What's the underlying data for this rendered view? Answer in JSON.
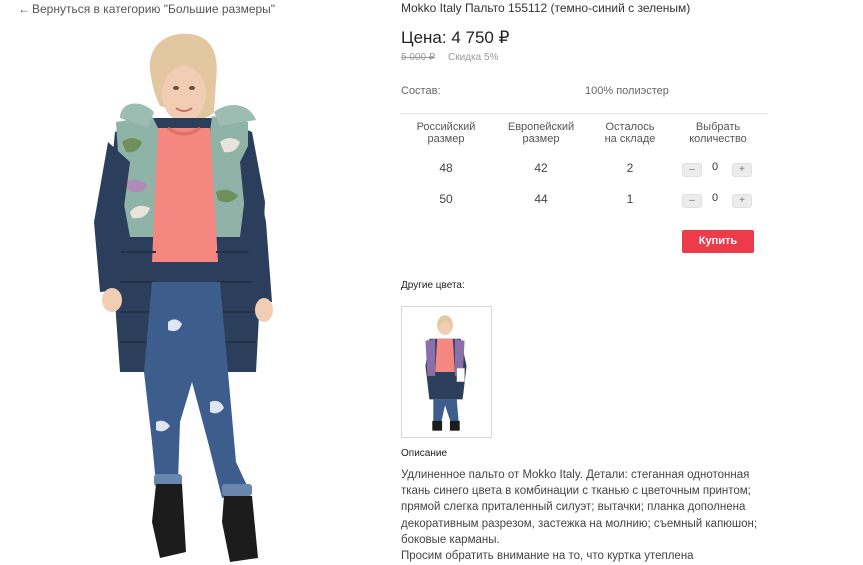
{
  "nav": {
    "back_arrow": "←",
    "back_label": "Вернуться в категорию \"Большие размеры\""
  },
  "product": {
    "title": "Mokko Italy Пальто 155112 (темно-синий с зеленым)",
    "price": "Цена: 4 750 ₽",
    "old_price": "5 000 ₽",
    "discount": "Скидка 5%",
    "composition_label": "Состав:",
    "composition_value": "100% полиэстер"
  },
  "size_table": {
    "headers": {
      "ru_size_1": "Российский",
      "ru_size_2": "размер",
      "eu_size_1": "Европейский",
      "eu_size_2": "размер",
      "stock_1": "Осталось",
      "stock_2": "на складе",
      "qty_1": "Выбрать",
      "qty_2": "количество"
    },
    "rows": [
      {
        "ru": "48",
        "eu": "42",
        "stock": "2",
        "qty": "0"
      },
      {
        "ru": "50",
        "eu": "44",
        "stock": "1",
        "qty": "0"
      }
    ],
    "minus_label": "–",
    "plus_label": "+"
  },
  "buy_label": "Купить",
  "other_colors_label": "Другие цвета:",
  "description": {
    "title": "Описание",
    "text": "Удлиненное пальто от Mokko Italy. Детали: стеганная однотонная ткань синего цвета в комбинации с тканью с цветочным принтом; прямой слегка приталенный силуэт; вытачки; планка дополнена декоративным разрезом, застежка на молнию; съемный капюшон; боковые карманы.",
    "note": "Просим обратить внимание на то, что куртка утеплена"
  },
  "colors": {
    "accent": "#ee3b4c",
    "coat": "#2b3f5c",
    "sweater": "#f4877f",
    "jeans": "#3d5e8c"
  }
}
